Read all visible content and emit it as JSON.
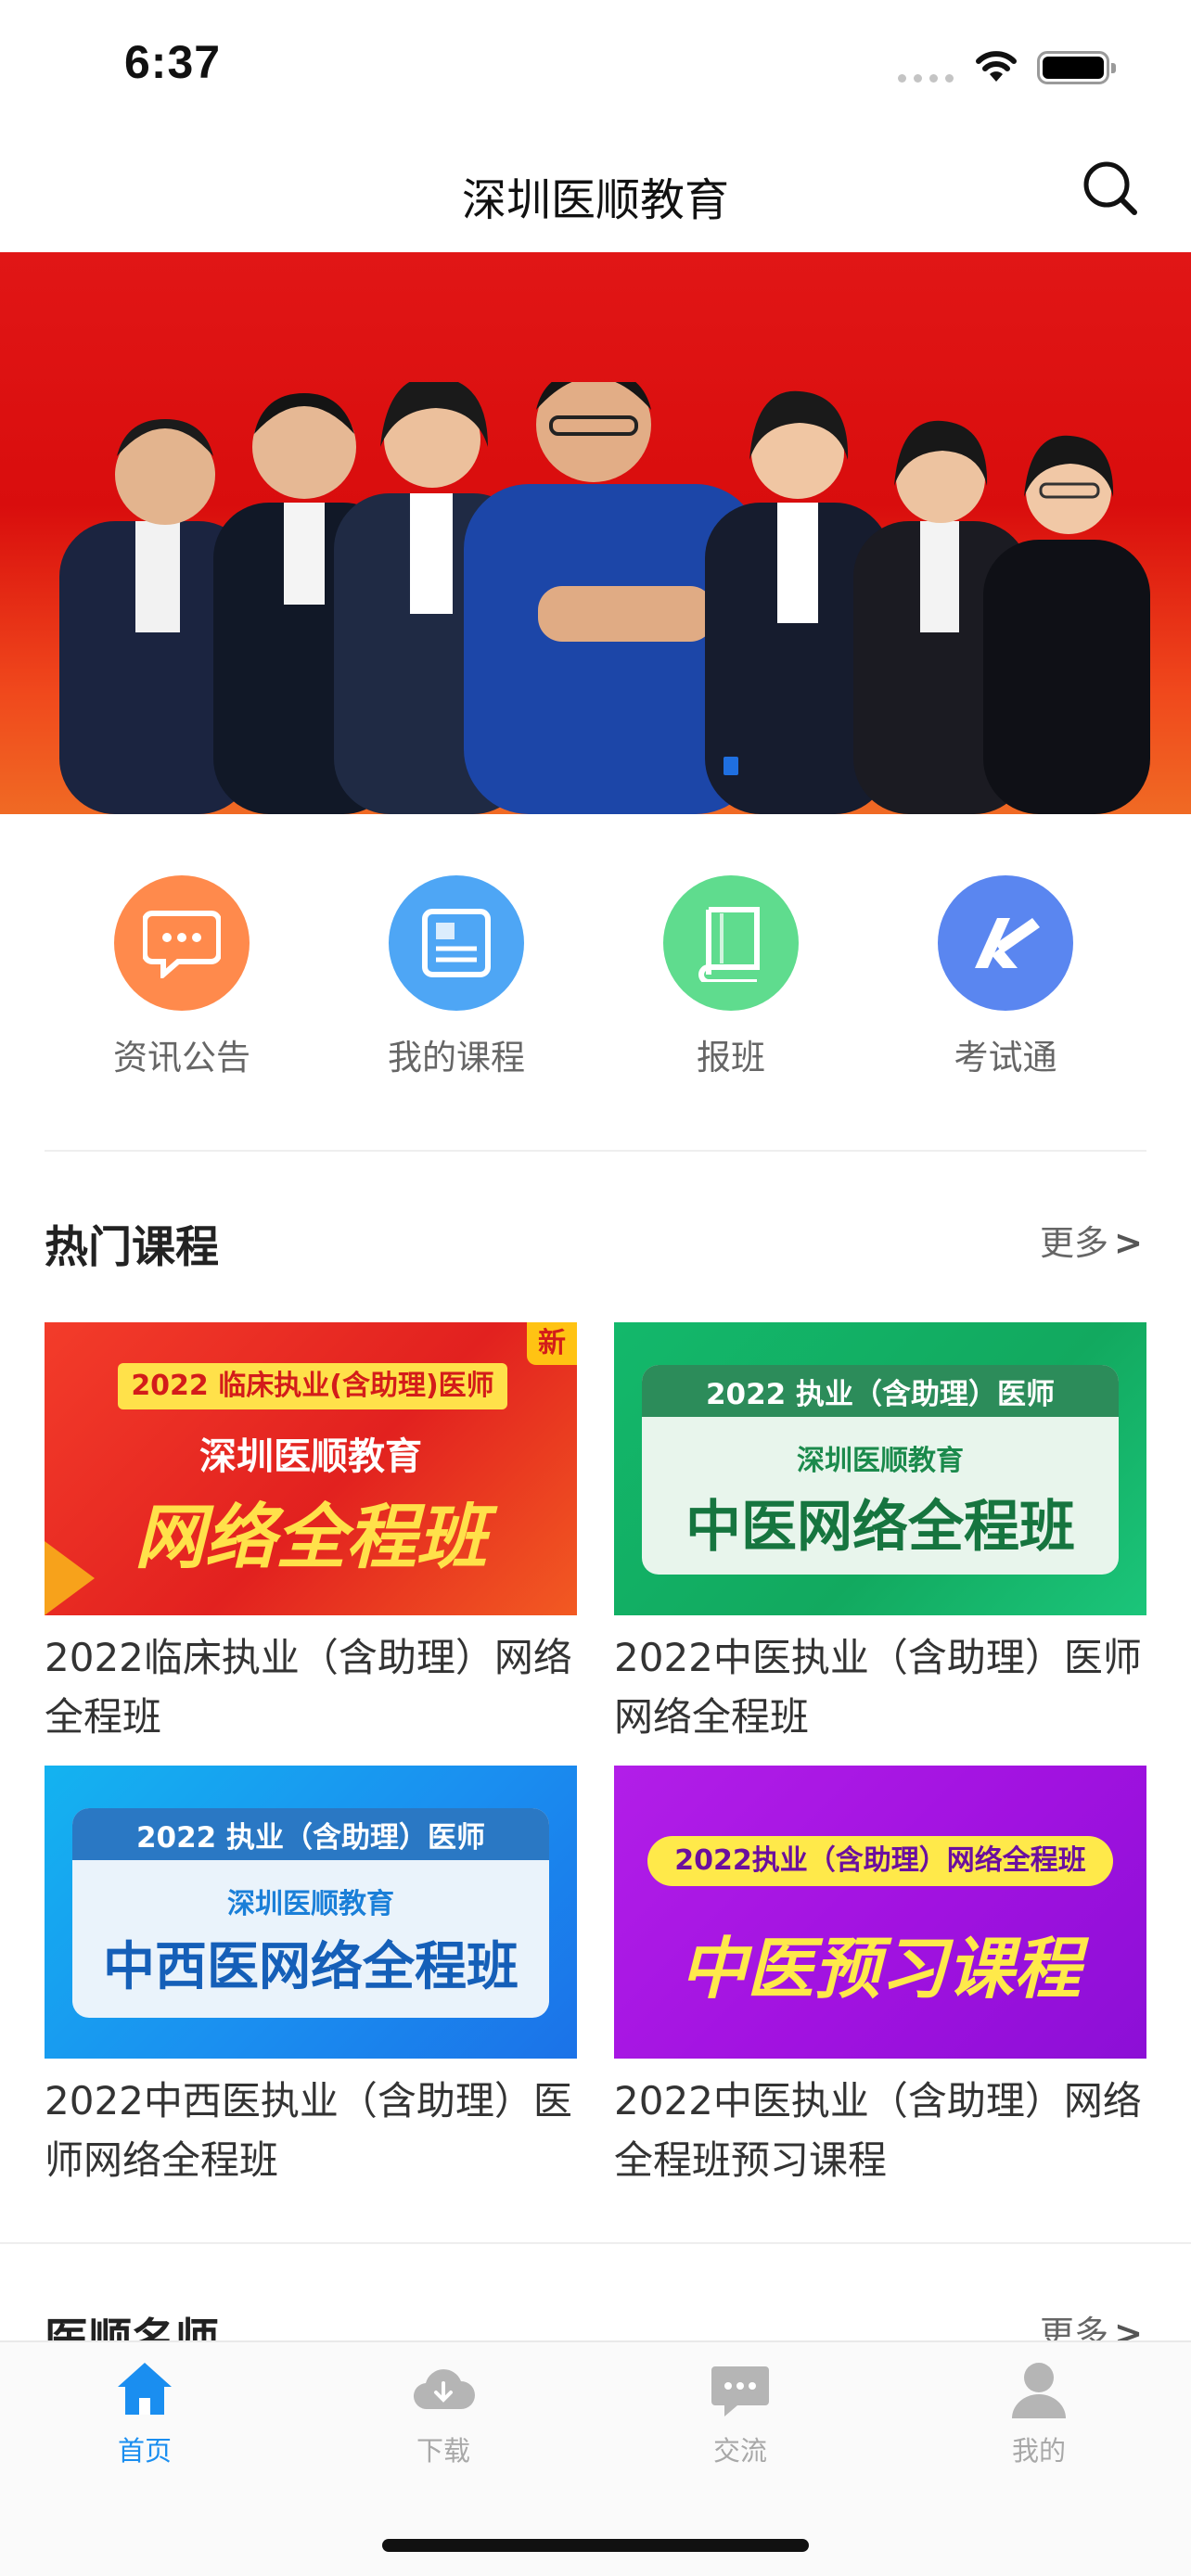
{
  "status_bar": {
    "time": "6:37"
  },
  "nav": {
    "title": "深圳医顺教育"
  },
  "quick_menu": [
    {
      "label": "资讯公告",
      "icon": "chat-bubble-icon",
      "color": "#ff8a4c"
    },
    {
      "label": "我的课程",
      "icon": "course-document-icon",
      "color": "#4ea6f5"
    },
    {
      "label": "报班",
      "icon": "book-icon",
      "color": "#5fdc8e"
    },
    {
      "label": "考试通",
      "icon": "exam-pen-icon",
      "color": "#5a86f0"
    }
  ],
  "hot_courses": {
    "title": "热门课程",
    "more": "更多",
    "more_arrow": ">",
    "items": [
      {
        "title": "2022临床执业（含助理）网络全程班",
        "thumb_tag": "2022 临床执业(含助理)医师",
        "thumb_brand": "深圳医顺教育",
        "thumb_main": "网络全程班",
        "thumb_badge": "新"
      },
      {
        "title": "2022中医执业（含助理）医师网络全程班",
        "thumb_tag": "2022 执业（含助理）医师",
        "thumb_brand": "深圳医顺教育",
        "thumb_main": "中医网络全程班"
      },
      {
        "title": "2022中西医执业（含助理）医师网络全程班",
        "thumb_tag": "2022 执业（含助理）医师",
        "thumb_brand": "深圳医顺教育",
        "thumb_main": "中西医网络全程班"
      },
      {
        "title": "2022中医执业（含助理）网络全程班预习课程",
        "thumb_tag": "2022执业（含助理）网络全程班",
        "thumb_main": "中医预习课程"
      }
    ]
  },
  "famous_teachers": {
    "title": "医顺名师",
    "more": "更多",
    "more_arrow": ">"
  },
  "tab_bar": [
    {
      "label": "首页",
      "icon": "home-icon",
      "active": true
    },
    {
      "label": "下载",
      "icon": "cloud-download-icon",
      "active": false
    },
    {
      "label": "交流",
      "icon": "chat-icon",
      "active": false
    },
    {
      "label": "我的",
      "icon": "user-icon",
      "active": false
    }
  ],
  "colors": {
    "accent": "#1a8ef0",
    "banner_red": "#e11616"
  }
}
